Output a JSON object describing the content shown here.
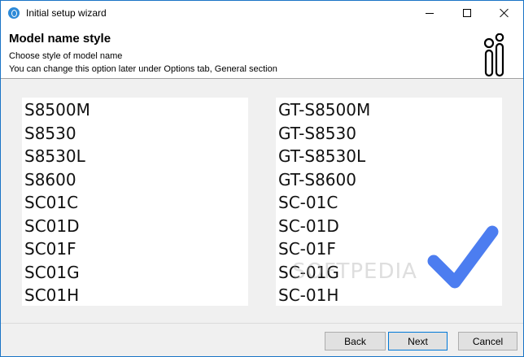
{
  "window": {
    "title": "Initial setup wizard"
  },
  "header": {
    "title": "Model name style",
    "subtitle_1": "Choose style of model name",
    "subtitle_2": "You can change this option later under Options tab, General section"
  },
  "options": {
    "left": {
      "models": [
        "S8500M",
        "S8530",
        "S8530L",
        "S8600",
        "SC01C",
        "SC01D",
        "SC01F",
        "SC01G",
        "SC01H"
      ]
    },
    "right": {
      "models": [
        "GT-S8500M",
        "GT-S8530",
        "GT-S8530L",
        "GT-S8600",
        "SC-01C",
        "SC-01D",
        "SC-01F",
        "SC-01G",
        "SC-01H"
      ],
      "selected": true
    }
  },
  "watermark": "SOFTPEDIA",
  "buttons": {
    "back": "Back",
    "next": "Next",
    "cancel": "Cancel"
  },
  "colors": {
    "accent": "#0078d7",
    "checkmark": "#4c7df0",
    "border": "#1a74c6"
  },
  "icons": {
    "app": "app-icon",
    "logo": "logo-icon",
    "selected": "checkmark-icon"
  }
}
